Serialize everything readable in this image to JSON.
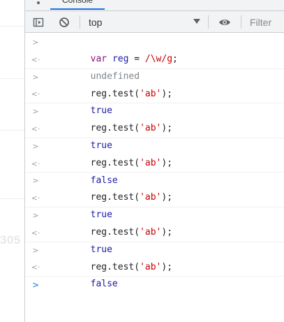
{
  "background_page": {
    "partial_number": "305"
  },
  "devtools": {
    "tabs": [
      {
        "label": "Console",
        "active": true
      }
    ],
    "toolbar": {
      "sidebar_toggle_icon": "sidebar-toggle-icon",
      "clear_icon": "clear-console-icon",
      "context": "top",
      "eye_icon": "live-expression-eye-icon",
      "filter_placeholder": "Filter"
    },
    "console": {
      "entries": [
        {
          "kind": "input",
          "keyword": "var",
          "name": "reg",
          "op": " = ",
          "regex": "/\\w/g",
          "end": ";"
        },
        {
          "kind": "output",
          "text": "undefined"
        },
        {
          "kind": "input",
          "pre": "reg.test(",
          "arg": "'ab'",
          "post": ");"
        },
        {
          "kind": "output",
          "text": "true"
        },
        {
          "kind": "input",
          "pre": "reg.test(",
          "arg": "'ab'",
          "post": ");"
        },
        {
          "kind": "output",
          "text": "true"
        },
        {
          "kind": "input",
          "pre": "reg.test(",
          "arg": "'ab'",
          "post": ");"
        },
        {
          "kind": "output",
          "text": "false"
        },
        {
          "kind": "input",
          "pre": "reg.test(",
          "arg": "'ab'",
          "post": ");"
        },
        {
          "kind": "output",
          "text": "true"
        },
        {
          "kind": "input",
          "pre": "reg.test(",
          "arg": "'ab'",
          "post": ");"
        },
        {
          "kind": "output",
          "text": "true"
        },
        {
          "kind": "input",
          "pre": "reg.test(",
          "arg": "'ab'",
          "post": ");"
        },
        {
          "kind": "output",
          "text": "false"
        }
      ],
      "input_glyph": ">",
      "output_glyph": "<·",
      "prompt_glyph": ">"
    },
    "colors": {
      "keyword": "#881280",
      "variable": "#1a1aa6",
      "string": "#c80000",
      "boolean": "#1a1aa6",
      "undefined": "#80868b",
      "active_tab": "#1a73e8"
    }
  }
}
